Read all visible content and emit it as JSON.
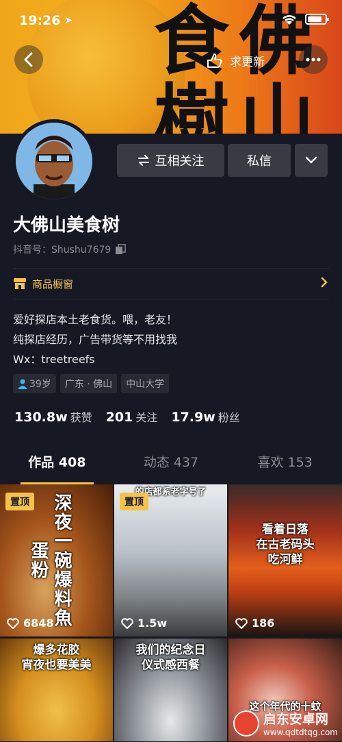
{
  "status_bar": {
    "time": "19:26"
  },
  "banner": {
    "glyphs": [
      "食",
      "佛",
      "樹",
      "山"
    ]
  },
  "nav": {
    "update_label": "求更新"
  },
  "profile": {
    "follow_label": "互相关注",
    "message_label": "私信",
    "name": "大佛山美食树",
    "douyin_id": "抖音号：Shushu7679",
    "shop_label": "商品橱窗",
    "bio": [
      "爱好探店本土老食货。喂，老友！",
      "纯探店经历，广告带货等不用找我",
      "Wx：treetreefs"
    ],
    "tags": [
      "39岁",
      "广东 · 佛山",
      "中山大学"
    ],
    "stats": [
      {
        "num": "130.8w",
        "label": "获赞"
      },
      {
        "num": "201",
        "label": "关注"
      },
      {
        "num": "17.9w",
        "label": "粉丝"
      }
    ]
  },
  "tabs": [
    {
      "label": "作品 408"
    },
    {
      "label": "动态 437"
    },
    {
      "label": "喜欢 153"
    }
  ],
  "videos": [
    {
      "pinned": "置顶",
      "likes": "6848",
      "caption": "深夜一碗爆料魚蛋粉"
    },
    {
      "pinned": "置顶",
      "likes": "1.5w",
      "caption": "的店都系老字号了"
    },
    {
      "likes": "186",
      "caption": [
        "看着日落",
        "在古老码头",
        "吃河鲜"
      ]
    },
    {
      "caption": [
        "爆多花胶",
        "宵夜也要美美"
      ]
    },
    {
      "caption": [
        "我们的纪念日",
        "仪式感西餐"
      ]
    },
    {
      "caption": "这个年代的十蚊"
    }
  ],
  "watermark": {
    "cn": "启东安卓网",
    "url": "www.qdtdtqg.com"
  },
  "colors": {
    "background": "#161823",
    "accent": "#f5c34a",
    "button": "#393b44"
  }
}
